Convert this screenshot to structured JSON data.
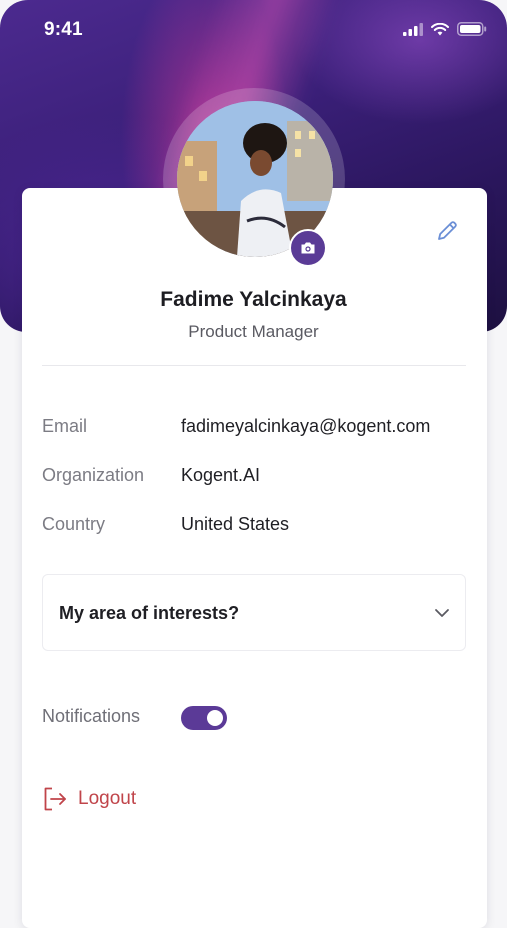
{
  "status_bar": {
    "time": "9:41"
  },
  "profile": {
    "name": "Fadime Yalcinkaya",
    "role": "Product Manager"
  },
  "info": {
    "email_label": "Email",
    "email_value": "fadimeyalcinkaya@kogent.com",
    "organization_label": "Organization",
    "organization_value": "Kogent.AI",
    "country_label": "Country",
    "country_value": "United States"
  },
  "interests": {
    "label": "My area of interests?"
  },
  "notifications": {
    "label": "Notifications",
    "enabled": true
  },
  "logout": {
    "label": "Logout"
  },
  "icons": {
    "camera": "camera-icon",
    "edit": "pencil-icon",
    "chevron": "chevron-down-icon",
    "logout": "logout-icon",
    "signal": "signal-icon",
    "wifi": "wifi-icon",
    "battery": "battery-icon"
  },
  "colors": {
    "accent": "#5b3a97",
    "logout": "#c0444a",
    "edit": "#6b8fd6"
  }
}
